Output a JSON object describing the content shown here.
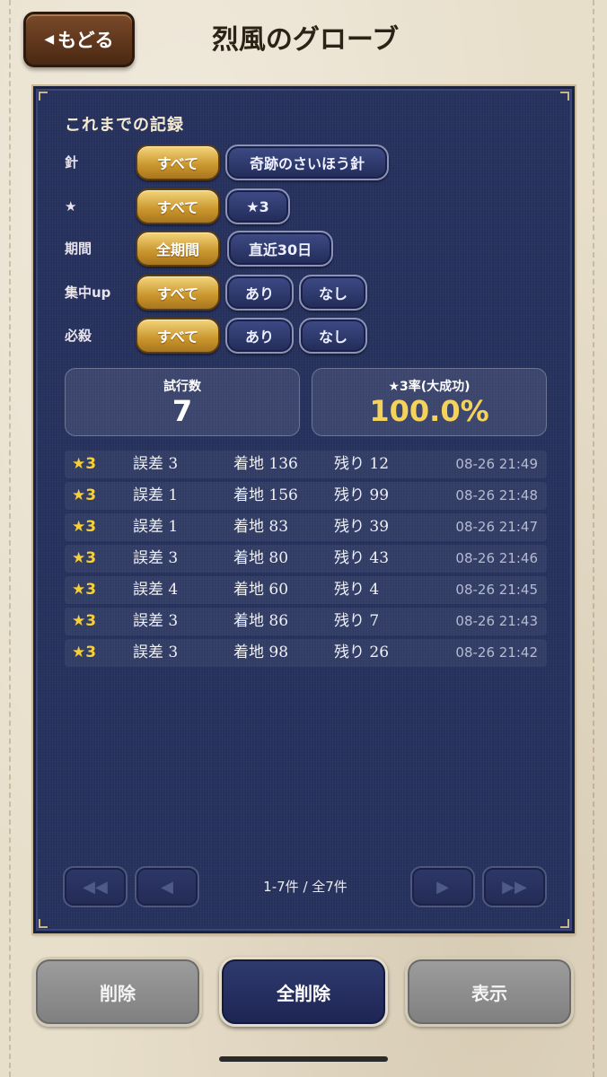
{
  "header": {
    "back_label": "もどる",
    "title": "烈風のグローブ"
  },
  "records": {
    "section_title": "これまでの記録",
    "filters": [
      {
        "label": "針",
        "options": [
          "すべて",
          "奇跡のさいほう針"
        ],
        "selected": "すべて"
      },
      {
        "label": "★",
        "options": [
          "すべて",
          "★3"
        ],
        "selected": "すべて"
      },
      {
        "label": "期間",
        "options": [
          "全期間",
          "直近30日"
        ],
        "selected": "全期間"
      },
      {
        "label": "集中up",
        "options": [
          "すべて",
          "あり",
          "なし"
        ],
        "selected": "すべて"
      },
      {
        "label": "必殺",
        "options": [
          "すべて",
          "あり",
          "なし"
        ],
        "selected": "すべて"
      }
    ],
    "stats": {
      "trials_label": "試行数",
      "trials_value": "7",
      "rate_label": "★3率(大成功)",
      "rate_value": "100.0%"
    },
    "rows": [
      {
        "star": "★3",
        "error": "誤差 3",
        "landing": "着地 136",
        "remaining": "残り 12",
        "time": "08-26 21:49"
      },
      {
        "star": "★3",
        "error": "誤差 1",
        "landing": "着地 156",
        "remaining": "残り 99",
        "time": "08-26 21:48"
      },
      {
        "star": "★3",
        "error": "誤差 1",
        "landing": "着地 83",
        "remaining": "残り 39",
        "time": "08-26 21:47"
      },
      {
        "star": "★3",
        "error": "誤差 3",
        "landing": "着地 80",
        "remaining": "残り 43",
        "time": "08-26 21:46"
      },
      {
        "star": "★3",
        "error": "誤差 4",
        "landing": "着地 60",
        "remaining": "残り 4",
        "time": "08-26 21:45"
      },
      {
        "star": "★3",
        "error": "誤差 3",
        "landing": "着地 86",
        "remaining": "残り 7",
        "time": "08-26 21:43"
      },
      {
        "star": "★3",
        "error": "誤差 3",
        "landing": "着地 98",
        "remaining": "残り 26",
        "time": "08-26 21:42"
      }
    ],
    "pagination": {
      "first_icon": "◀◀",
      "prev_icon": "◀",
      "next_icon": "▶",
      "last_icon": "▶▶",
      "info": "1-7件 / 全7件"
    }
  },
  "actions": {
    "delete_label": "削除",
    "delete_all_label": "全削除",
    "show_label": "表示"
  },
  "colors": {
    "panel": "#27325e",
    "gold": "#c9952c",
    "star": "#f6cf39",
    "rate": "#f5d35b"
  }
}
